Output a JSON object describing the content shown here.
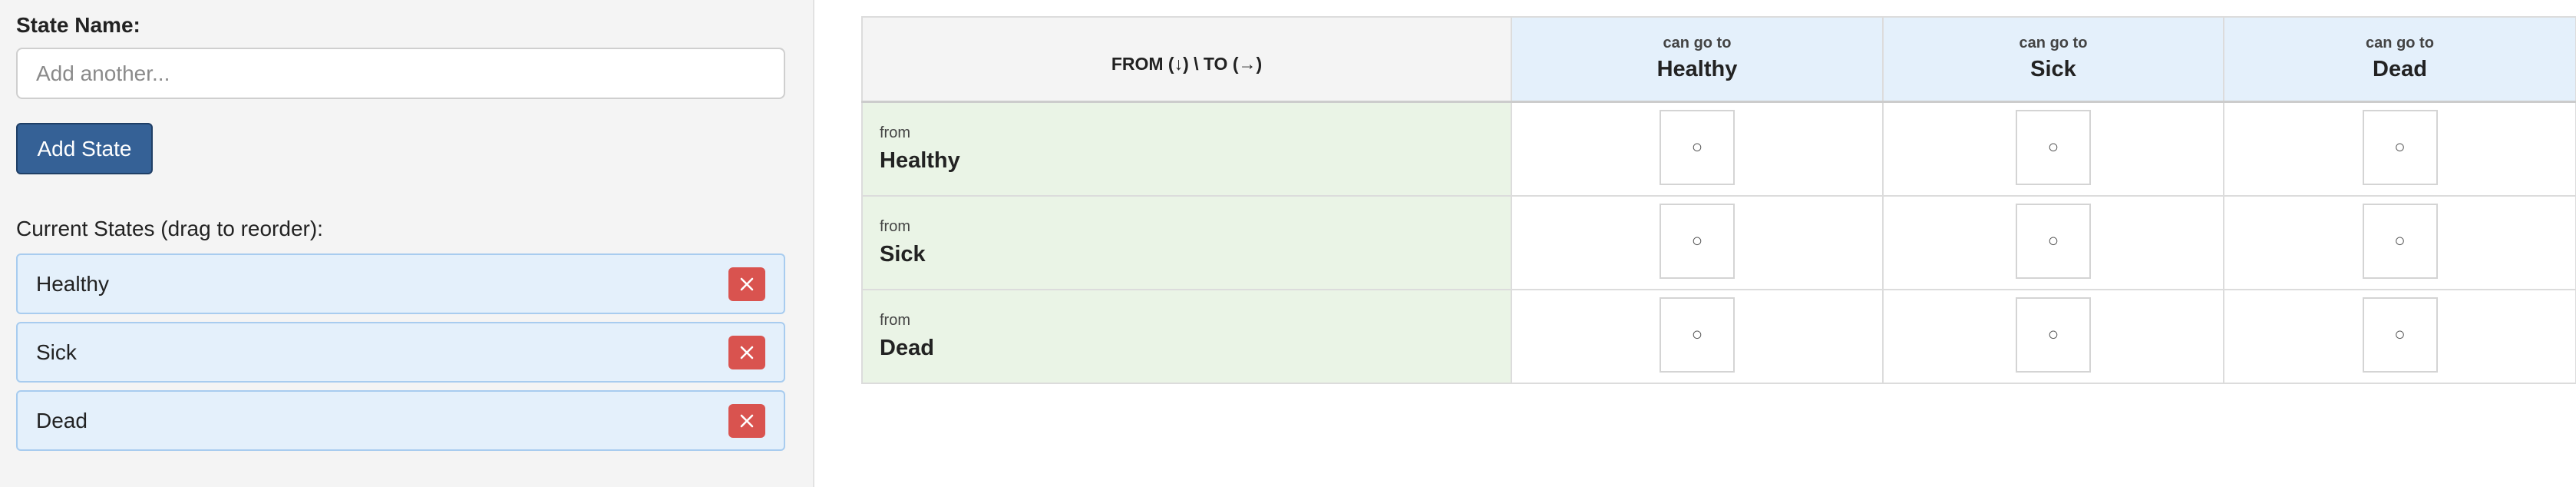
{
  "form": {
    "state_name_label": "State Name:",
    "input_placeholder": "Add another...",
    "add_button": "Add State",
    "current_states_title": "Current States (drag to reorder):"
  },
  "states": [
    {
      "name": "Healthy",
      "delete_icon": "close-icon"
    },
    {
      "name": "Sick",
      "delete_icon": "close-icon"
    },
    {
      "name": "Dead",
      "delete_icon": "close-icon"
    }
  ],
  "matrix": {
    "corner_label": "FROM (↓) \\ TO (→)",
    "col_prefix": "can go to",
    "row_prefix": "from",
    "columns": [
      "Healthy",
      "Sick",
      "Dead"
    ],
    "rows": [
      "Healthy",
      "Sick",
      "Dead"
    ],
    "cell_mark": "○"
  },
  "colors": {
    "add_button": "#356196",
    "delete_button": "#d9534f",
    "state_item_bg": "#e4f0fb",
    "row_header_bg": "#eaf4e6",
    "col_header_bg": "#e4f0fb"
  }
}
